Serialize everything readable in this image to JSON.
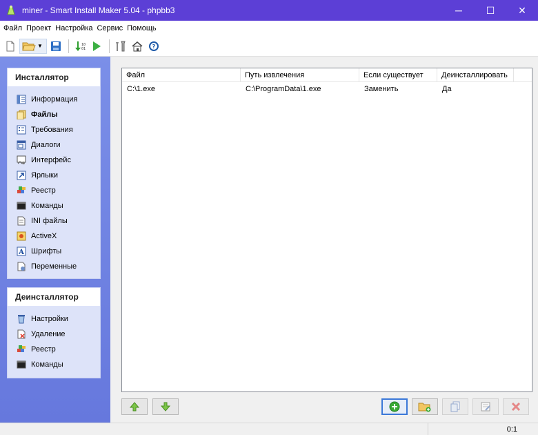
{
  "window": {
    "title": "miner - Smart Install Maker 5.04 - phpbb3",
    "minimize_glyph": "─",
    "maximize_glyph": "☐",
    "close_glyph": "✕"
  },
  "menu": [
    "Файл",
    "Проект",
    "Настройка",
    "Сервис",
    "Помощь"
  ],
  "toolbar": {
    "icons": [
      "new-file-icon",
      "open-folder-icon",
      "save-icon",
      "build-icon",
      "run-icon",
      "tools-icon",
      "home-icon",
      "help-icon"
    ]
  },
  "sidebar": {
    "installer": {
      "header": "Инсталлятор",
      "items": [
        {
          "label": "Информация",
          "icon": "info-icon"
        },
        {
          "label": "Файлы",
          "icon": "files-icon",
          "active": true
        },
        {
          "label": "Требования",
          "icon": "requirements-icon"
        },
        {
          "label": "Диалоги",
          "icon": "dialogs-icon"
        },
        {
          "label": "Интерфейс",
          "icon": "interface-icon"
        },
        {
          "label": "Ярлыки",
          "icon": "shortcuts-icon"
        },
        {
          "label": "Реестр",
          "icon": "registry-icon"
        },
        {
          "label": "Команды",
          "icon": "commands-icon"
        },
        {
          "label": "INI файлы",
          "icon": "ini-files-icon"
        },
        {
          "label": "ActiveX",
          "icon": "activex-icon"
        },
        {
          "label": "Шрифты",
          "icon": "fonts-icon"
        },
        {
          "label": "Переменные",
          "icon": "variables-icon"
        }
      ]
    },
    "uninstaller": {
      "header": "Деинсталлятор",
      "items": [
        {
          "label": "Настройки",
          "icon": "settings-icon"
        },
        {
          "label": "Удаление",
          "icon": "delete-icon"
        },
        {
          "label": "Реестр",
          "icon": "registry-icon"
        },
        {
          "label": "Команды",
          "icon": "commands-icon"
        }
      ]
    }
  },
  "file_list": {
    "columns": [
      "Файл",
      "Путь извлечения",
      "Если существует",
      "Деинсталлировать"
    ],
    "rows": [
      [
        "C:\\1.exe",
        "C:\\ProgramData\\1.exe",
        "Заменить",
        "Да"
      ]
    ]
  },
  "bottom_buttons": {
    "left": [
      "move-up-icon",
      "move-down-icon"
    ],
    "right": [
      "add-file-icon",
      "add-folder-icon",
      "copy-icon",
      "edit-icon",
      "remove-icon"
    ]
  },
  "statusbar": {
    "position": "0:1"
  },
  "colors": {
    "titlebar": "#5c3fd6",
    "sidebar": "#7b8fe8",
    "panel": "#dde3f9"
  }
}
